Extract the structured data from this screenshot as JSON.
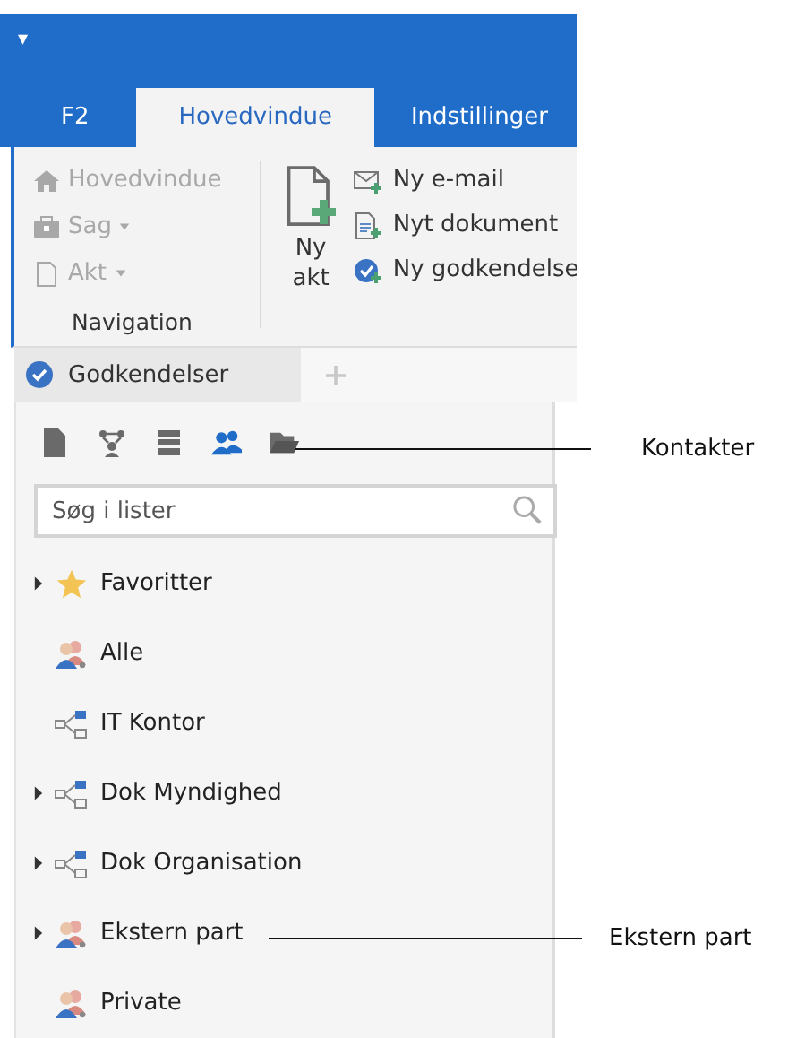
{
  "quick_access": {
    "icon": "▾"
  },
  "tabs": [
    {
      "label": "F2",
      "selected": false
    },
    {
      "label": "Hovedvindue",
      "selected": true
    },
    {
      "label": "Indstillinger",
      "selected": false
    }
  ],
  "ribbon": {
    "navigation": {
      "label": "Navigation",
      "items": [
        {
          "label": "Hovedvindue",
          "kind": "home",
          "disabled": true,
          "dropdown": false
        },
        {
          "label": "Sag",
          "kind": "case",
          "disabled": true,
          "dropdown": true
        },
        {
          "label": "Akt",
          "kind": "doc",
          "disabled": true,
          "dropdown": true
        }
      ]
    },
    "new_act": {
      "label_lines": [
        "Ny",
        "akt"
      ]
    },
    "new_items": [
      {
        "label": "Ny e-mail",
        "kind": "mail"
      },
      {
        "label": "Nyt dokument",
        "kind": "document"
      },
      {
        "label": "Ny godkendelse",
        "kind": "approval"
      }
    ]
  },
  "doc_tabs": [
    {
      "label": "Godkendelser",
      "selected": true
    }
  ],
  "panel": {
    "toolbar": [
      {
        "kind": "document",
        "selected": false
      },
      {
        "kind": "org",
        "selected": false
      },
      {
        "kind": "list",
        "selected": false
      },
      {
        "kind": "contacts",
        "selected": true
      },
      {
        "kind": "folder",
        "selected": false
      }
    ],
    "search": {
      "placeholder": "Søg i lister"
    },
    "tree": [
      {
        "label": "Favoritter",
        "kind": "favorites",
        "expandable": true
      },
      {
        "label": "Alle",
        "kind": "people",
        "expandable": false
      },
      {
        "label": "IT Kontor",
        "kind": "org",
        "expandable": false
      },
      {
        "label": "Dok Myndighed",
        "kind": "org",
        "expandable": true
      },
      {
        "label": "Dok Organisation",
        "kind": "org",
        "expandable": true
      },
      {
        "label": "Ekstern part",
        "kind": "people",
        "expandable": true
      },
      {
        "label": "Private",
        "kind": "people",
        "expandable": false
      }
    ]
  },
  "callouts": [
    {
      "label": "Kontakter"
    },
    {
      "label": "Ekstern part"
    }
  ]
}
